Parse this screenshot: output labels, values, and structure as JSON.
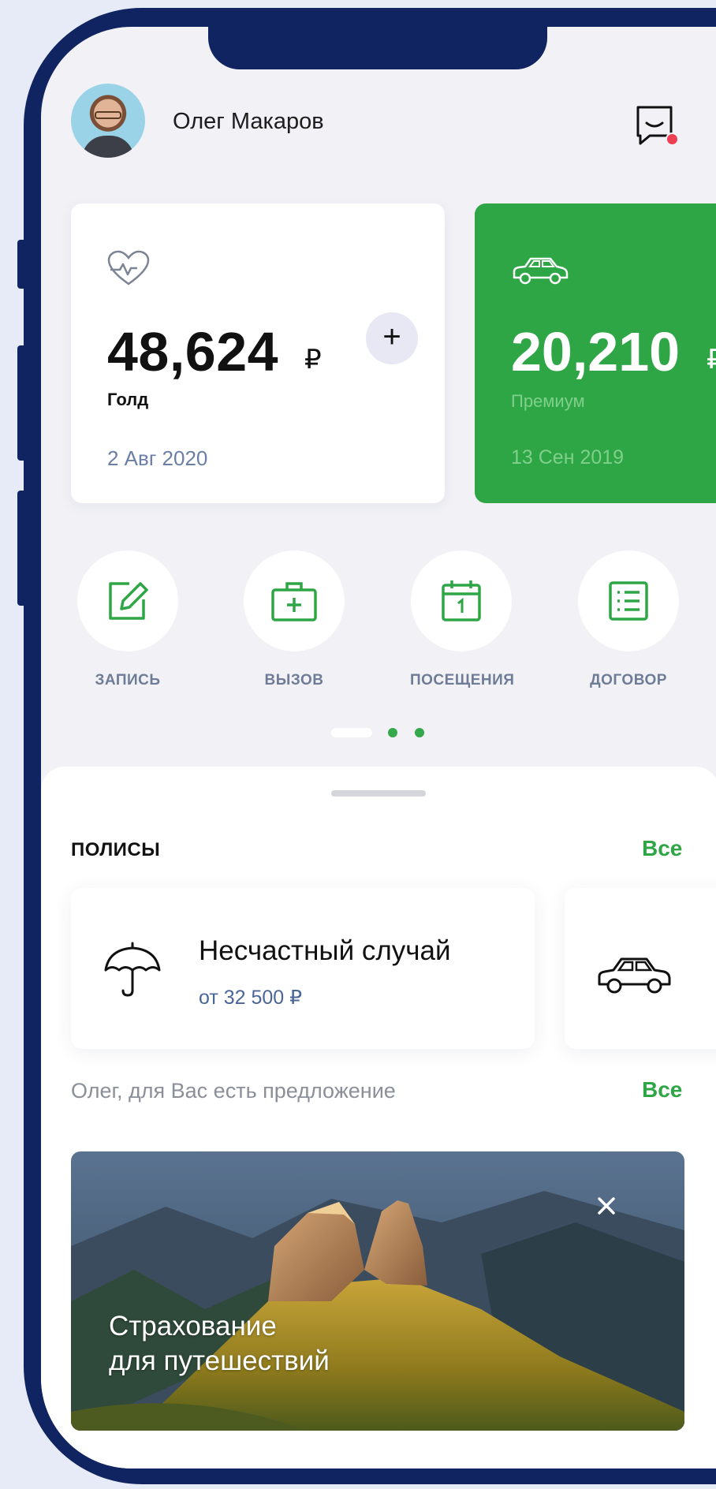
{
  "user": {
    "name": "Олег Макаров"
  },
  "cards": [
    {
      "amount": "48,624",
      "currency": "₽",
      "plan": "Голд",
      "date": "2 Авг 2020",
      "icon": "heart-pulse-icon"
    },
    {
      "amount": "20,210",
      "currency": "₽",
      "plan": "Премиум",
      "date": "13 Сен 2019",
      "icon": "car-icon"
    }
  ],
  "add_button": "+",
  "actions": [
    {
      "label": "ЗАПИСЬ",
      "icon": "edit-icon"
    },
    {
      "label": "ВЫЗОВ",
      "icon": "medical-kit-icon"
    },
    {
      "label": "ПОСЕЩЕНИЯ",
      "icon": "calendar-icon"
    },
    {
      "label": "ДОГОВОР",
      "icon": "list-icon"
    }
  ],
  "policies": {
    "title": "ПОЛИСЫ",
    "all": "Все",
    "items": [
      {
        "title": "Несчастный случай",
        "price": "от 32 500 ₽",
        "icon": "umbrella-icon"
      },
      {
        "icon": "car-icon"
      }
    ]
  },
  "offers": {
    "title": "Олег, для Вас есть предложение",
    "all": "Все",
    "banner_line1": "Страхование",
    "banner_line2": "для путешествий",
    "close": "×"
  },
  "colors": {
    "accent": "#2ea646",
    "frame": "#0f2460",
    "background": "#f1f1f6"
  }
}
